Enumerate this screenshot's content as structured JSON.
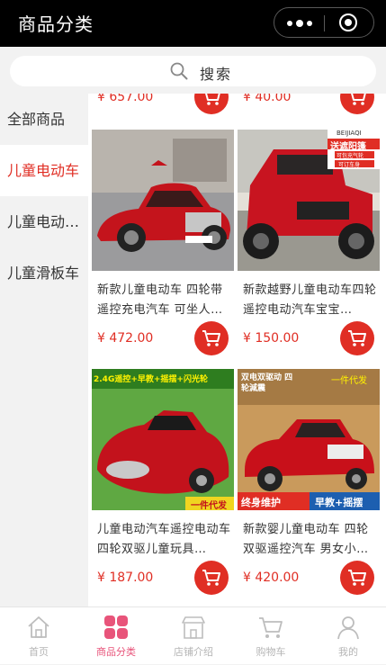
{
  "header": {
    "title": "商品分类"
  },
  "search": {
    "label": "搜索"
  },
  "sidebar": {
    "items": [
      {
        "label": "全部商品"
      },
      {
        "label": "儿童电动车"
      },
      {
        "label": "儿童电动…"
      },
      {
        "label": "儿童滑板车"
      }
    ],
    "active_index": 1
  },
  "products": {
    "top_prices": [
      "¥ 657.00",
      "¥ 40.00"
    ],
    "rows": [
      [
        {
          "name": "新款儿童电动车 四轮带遥控充电汽车 可坐人…",
          "price": "¥ 472.00"
        },
        {
          "name": "新款越野儿童电动车四轮遥控电动汽车宝宝…",
          "price": "¥ 150.00",
          "badge": "BEIJIAQI",
          "badge2": "送遮阳篷",
          "badge3": "可包充气轮",
          "badge4": "可订车身"
        }
      ],
      [
        {
          "name": "儿童电动汽车遥控电动车 四轮双驱儿童玩具…",
          "price": "¥ 187.00",
          "banner": "2.4G遥控+早教+摇摆+闪光轮",
          "tag": "一件代发"
        },
        {
          "name": "新款婴儿童电动车 四轮双驱遥控汽车 男女小…",
          "price": "¥ 420.00",
          "banner": "双电双驱动 四轮減震",
          "tag": "一件代发",
          "strip1": "终身维护",
          "strip2": "早教+摇摆"
        }
      ]
    ]
  },
  "tabbar": {
    "items": [
      {
        "label": "首页",
        "icon": "home-icon"
      },
      {
        "label": "商品分类",
        "icon": "category-icon"
      },
      {
        "label": "店铺介绍",
        "icon": "shop-icon"
      },
      {
        "label": "购物车",
        "icon": "cart-icon"
      },
      {
        "label": "我的",
        "icon": "user-icon"
      }
    ],
    "active_index": 1
  },
  "colors": {
    "accent": "#e02e24",
    "tab_active": "#e8547a",
    "header_bg": "#000000"
  }
}
